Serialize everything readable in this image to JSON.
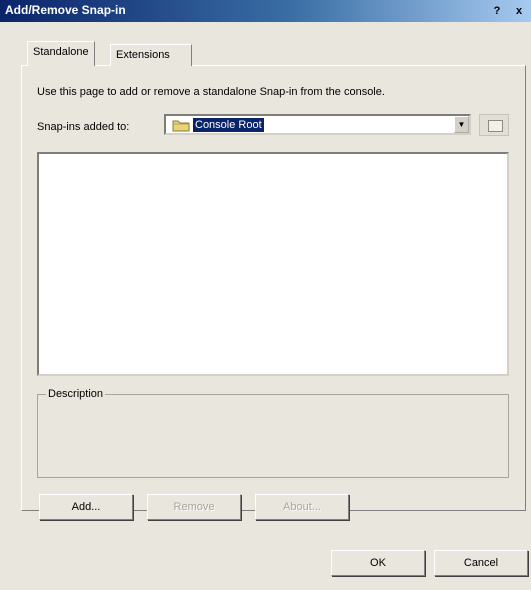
{
  "window": {
    "title": "Add/Remove Snap-in",
    "help_glyph": "?",
    "close_glyph": "x"
  },
  "tabs": [
    {
      "label": "Standalone",
      "active": true
    },
    {
      "label": "Extensions",
      "active": false
    }
  ],
  "standalone": {
    "intro_text": "Use this page to add or remove a standalone Snap-in from the console.",
    "snapins_label": "Snap-ins added to:",
    "snapins_selected": "Console Root",
    "description_label": "Description",
    "snapins_list": []
  },
  "buttons": {
    "add": "Add...",
    "remove": "Remove",
    "about": "About...",
    "ok": "OK",
    "cancel": "Cancel"
  },
  "icons": {
    "folder": "folder-icon",
    "browse": "up-folder-icon",
    "dropdown": "chevron-down-icon"
  },
  "colors": {
    "title_bar": "#0a246a",
    "selection": "#0a246a",
    "dialog_face": "#e9e6de"
  }
}
